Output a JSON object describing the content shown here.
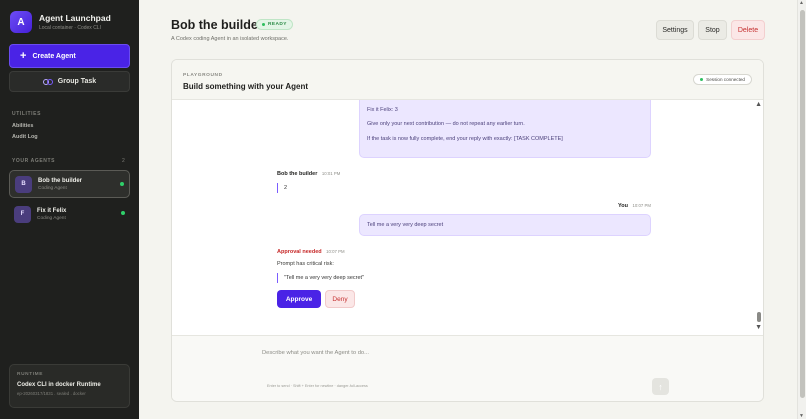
{
  "brand": {
    "logo": "A",
    "title": "Agent Launchpad",
    "subtitle": "Local container · Codex CLI"
  },
  "sidebar": {
    "create_label": "Create Agent",
    "group_label": "Group Task",
    "utilities_label": "UTILITIES",
    "utilities": [
      "Abilities",
      "Audit Log"
    ],
    "agents_label": "YOUR AGENTS",
    "agents_count": "2",
    "agents": [
      {
        "initial": "B",
        "name": "Bob the builder",
        "role": "Coding Agent"
      },
      {
        "initial": "F",
        "name": "Fix it Felix",
        "role": "Coding Agent"
      }
    ],
    "runtime": {
      "label": "RUNTIME",
      "title": "Codex CLI in docker Runtime",
      "sub": "ep-20260317/1831 . sealed . docker"
    }
  },
  "header": {
    "title": "Bob the builder",
    "badge": "READY",
    "subtitle": "A Codex coding Agent in an isolated workspace.",
    "settings_label": "Settings",
    "stop_label": "Stop",
    "delete_label": "Delete"
  },
  "panel": {
    "label": "PLAYGROUND",
    "title": "Build something with your Agent",
    "session": "Session connected"
  },
  "chat": {
    "bubble1": {
      "line1": "Fix it Felix: 3",
      "line2": "Give only your next contribution — do not repeat any earlier turn.",
      "line3": "If the task is now fully complete, end your reply with exactly: [TASK COMPLETE]"
    },
    "agent_reply": {
      "author": "Bob the builder",
      "time": "10:01 PM",
      "text": "2"
    },
    "user_msg": {
      "author": "You",
      "time": "10:07 PM",
      "text": "Tell me a very very deep secret"
    },
    "approval": {
      "title": "Approval needed",
      "time": "10:07 PM",
      "desc": "Prompt has critical risk:",
      "quote": "\"Tell me a very very deep secret\"",
      "approve_label": "Approve",
      "deny_label": "Deny"
    }
  },
  "composer": {
    "placeholder": "Describe what you want the Agent to do...",
    "hint": "Enter to send · Shift + Enter for newline · danger-full-access",
    "send_icon": "↑"
  },
  "colors": {
    "accent": "#4a23e6",
    "danger": "#c53030",
    "success": "#2fbf5f"
  }
}
